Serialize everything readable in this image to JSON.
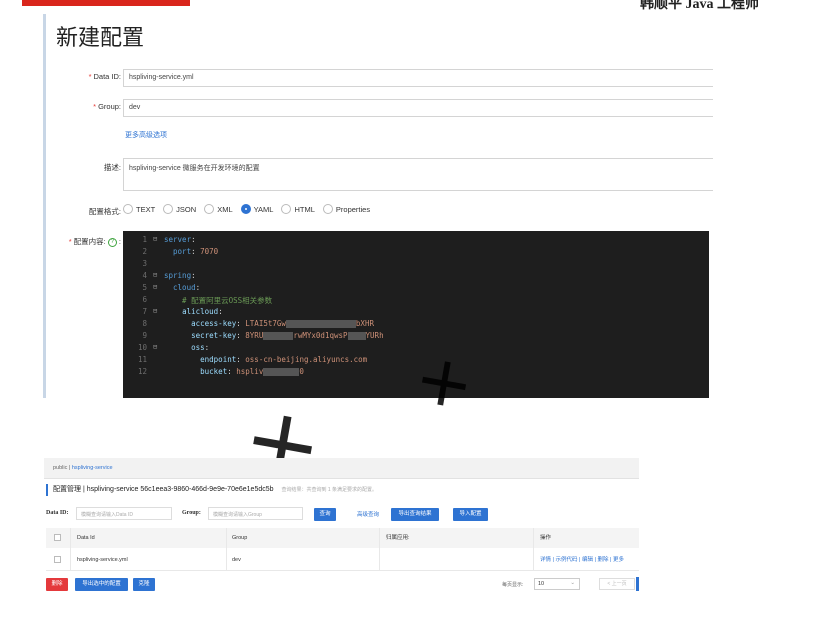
{
  "header": {
    "right_text": "韩顺平 Java 工程师"
  },
  "form": {
    "title": "新建配置",
    "data_id_label": "Data ID:",
    "data_id_value": "hspliving-service.yml",
    "group_label": "Group:",
    "group_value": "dev",
    "more_options": "更多高级选项",
    "desc_label": "描述:",
    "desc_value": "hspliving-service 微服务在开发环境的配置",
    "format_label": "配置格式:",
    "formats": [
      "TEXT",
      "JSON",
      "XML",
      "YAML",
      "HTML",
      "Properties"
    ],
    "selected_format": "YAML",
    "content_label": "配置内容:",
    "help_icon_text": "?"
  },
  "editor": {
    "lines": [
      {
        "n": "1",
        "fold": "⊟",
        "text": "server:"
      },
      {
        "n": "2",
        "fold": "",
        "text": "  port: 7070"
      },
      {
        "n": "3",
        "fold": "",
        "text": ""
      },
      {
        "n": "4",
        "fold": "⊟",
        "text": "spring:"
      },
      {
        "n": "5",
        "fold": "⊟",
        "text": "  cloud:"
      },
      {
        "n": "6",
        "fold": "",
        "text": "    # 配置阿里云OSS相关参数"
      },
      {
        "n": "7",
        "fold": "⊟",
        "text": "    alicloud:"
      },
      {
        "n": "8",
        "fold": "",
        "text": "      access-key: LTAI5t7Gw"
      },
      {
        "n": "9",
        "fold": "",
        "text": "      secret-key: 8YRU"
      },
      {
        "n": "10",
        "fold": "⊟",
        "text": "      oss:"
      },
      {
        "n": "11",
        "fold": "",
        "text": "        endpoint: oss-cn-beijing.aliyuncs.com"
      },
      {
        "n": "12",
        "fold": "",
        "text": "        bucket: hspliv"
      }
    ],
    "access_key_tail": "bXHR",
    "secret_key_mid": "rwMYx0d1qwsP",
    "secret_key_tail": "YURh",
    "bucket_tail": "0"
  },
  "list": {
    "crumb_ns": "public",
    "crumb_sep": "|",
    "crumb_service": "hspliving-service",
    "title": "配置管理 | hspliving-service 56c1eea3-9860-466d-9e9e-70e6e1e5dc5b",
    "title_tip": "查询结果：共查询到 1 条满足要求的配置。",
    "filter_dataid_label": "Data ID:",
    "filter_dataid_placeholder": "模糊查询请输入Data ID",
    "filter_group_label": "Group:",
    "filter_group_placeholder": "模糊查询请输入Group",
    "btn_query": "查询",
    "link_adv_query": "高级查询",
    "btn_export_query": "导出查询结果",
    "btn_import": "导入配置",
    "columns": [
      "Data Id",
      "Group",
      "归属应用:",
      "操作"
    ],
    "rows": [
      {
        "data_id": "hspliving-service.yml",
        "group": "dev",
        "app": "",
        "ops": "详情 | 示例代码 | 编辑 | 删除 | 更多"
      }
    ],
    "btn_delete": "删除",
    "btn_export_selected": "导出选中的配置",
    "btn_clone": "克隆",
    "page_size_label": "每页显示:",
    "page_size_value": "10",
    "prev_label": "< 上一页"
  }
}
